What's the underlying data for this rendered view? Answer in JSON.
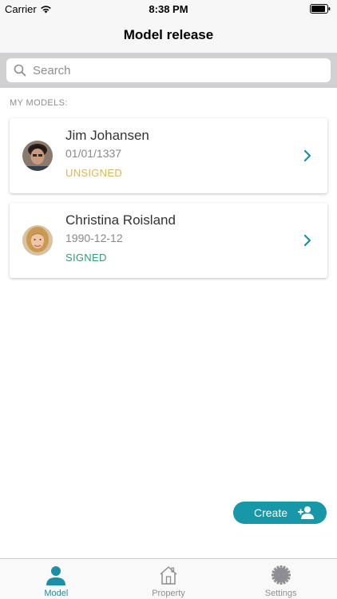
{
  "status_bar": {
    "carrier": "Carrier",
    "time": "8:38 PM"
  },
  "nav": {
    "title": "Model release"
  },
  "search": {
    "placeholder": "Search"
  },
  "section": {
    "header": "MY MODELS:"
  },
  "models": [
    {
      "name": "Jim Johansen",
      "date": "01/01/1337",
      "status": "UNSIGNED"
    },
    {
      "name": "Christina Roisland",
      "date": "1990-12-12",
      "status": "SIGNED"
    }
  ],
  "create_button": {
    "label": "Create"
  },
  "tabs": [
    {
      "label": "Model",
      "icon": "person-icon",
      "active": true
    },
    {
      "label": "Property",
      "icon": "house-icon",
      "active": false
    },
    {
      "label": "Settings",
      "icon": "gear-icon",
      "active": false
    }
  ],
  "colors": {
    "accent": "#1797a8",
    "unsigned": "#e0b455",
    "signed": "#2e9f6e",
    "search_bg": "#d1d1d3"
  }
}
